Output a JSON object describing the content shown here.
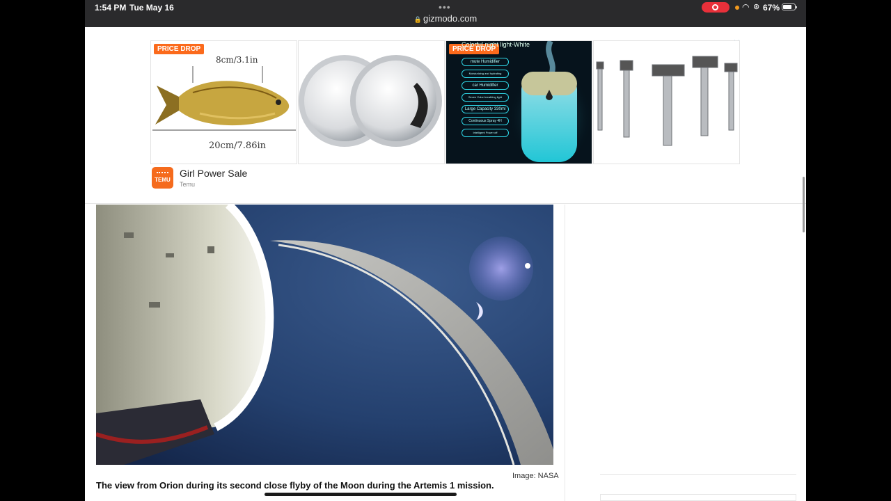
{
  "status_bar": {
    "time": "1:54 PM",
    "date": "Tue May 16",
    "battery": "67%",
    "url": "gizmodo.com"
  },
  "ad": {
    "tiles": [
      {
        "badge": "PRICE DROP",
        "dim_top": "8cm/3.1in",
        "dim_bottom": "20cm/7.86in",
        "icon": "fish-toy-image"
      },
      {
        "icon": "blind-spot-mirrors-image"
      },
      {
        "badge": "PRICE DROP",
        "overlay_title": "Colorful night light-White",
        "features": [
          "mute Humidifier",
          "Moisturizing and hydrating",
          "car Humidifier",
          "Seven Color breathing light",
          "Large Capacity 330ml",
          "Continuous Spray 4H",
          "Intelligent Power off"
        ],
        "icon": "humidifier-image"
      },
      {
        "icon": "drill-bits-image"
      }
    ],
    "advertiser_title": "Girl Power Sale",
    "advertiser_sub": "Temu",
    "logo_text": "TEMU"
  },
  "article": {
    "image_credit": "Image: NASA",
    "caption": "The view from Orion during its second close flyby of the Moon during the Artemis 1 mission."
  },
  "colors": {
    "accent_orange": "#fb6a1c",
    "record_red": "#e8303a",
    "adchoices_blue": "#3b9ad9"
  }
}
